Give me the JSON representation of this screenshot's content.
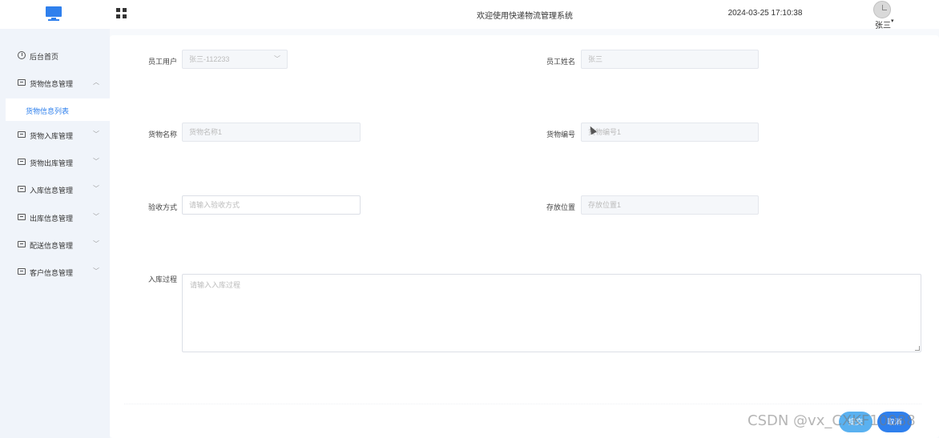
{
  "header": {
    "title": "欢迎使用快递物流管理系统",
    "datetime": "2024-03-25 17:10:38",
    "user_name": "张三",
    "user_chevron": "▾"
  },
  "sidebar": {
    "items": [
      {
        "label": "后台首页",
        "icon": "clock-icon",
        "chevron": ""
      },
      {
        "label": "货物信息管理",
        "icon": "list-icon",
        "chevron": "︿"
      },
      {
        "label": "货物入库管理",
        "icon": "list-icon",
        "chevron": "﹀"
      },
      {
        "label": "货物出库管理",
        "icon": "list-icon",
        "chevron": "﹀"
      },
      {
        "label": "入库信息管理",
        "icon": "list-icon",
        "chevron": "﹀"
      },
      {
        "label": "出库信息管理",
        "icon": "list-icon",
        "chevron": "﹀"
      },
      {
        "label": "配送信息管理",
        "icon": "list-icon",
        "chevron": "﹀"
      },
      {
        "label": "客户信息管理",
        "icon": "list-icon",
        "chevron": "﹀"
      }
    ],
    "active_sub": "货物信息列表"
  },
  "form": {
    "employee_user": {
      "label": "员工用户",
      "value": "张三-112233"
    },
    "employee_name": {
      "label": "员工姓名",
      "value": "张三"
    },
    "goods_name": {
      "label": "货物名称",
      "value": "货物名称1"
    },
    "goods_code": {
      "label": "货物编号",
      "value": "货物编号1"
    },
    "acceptance": {
      "label": "验收方式",
      "placeholder": "请输入验收方式"
    },
    "location": {
      "label": "存放位置",
      "value": "存放位置1"
    },
    "process": {
      "label": "入库过程",
      "placeholder": "请输入入库过程"
    }
  },
  "buttons": {
    "submit": "提交",
    "cancel": "取消"
  },
  "watermark": "CSDN @vx_CXKF10088",
  "colors": {
    "accent": "#2f80ed",
    "submit": "#5ab1f0",
    "sidebar_bg": "#f0f4fa"
  }
}
